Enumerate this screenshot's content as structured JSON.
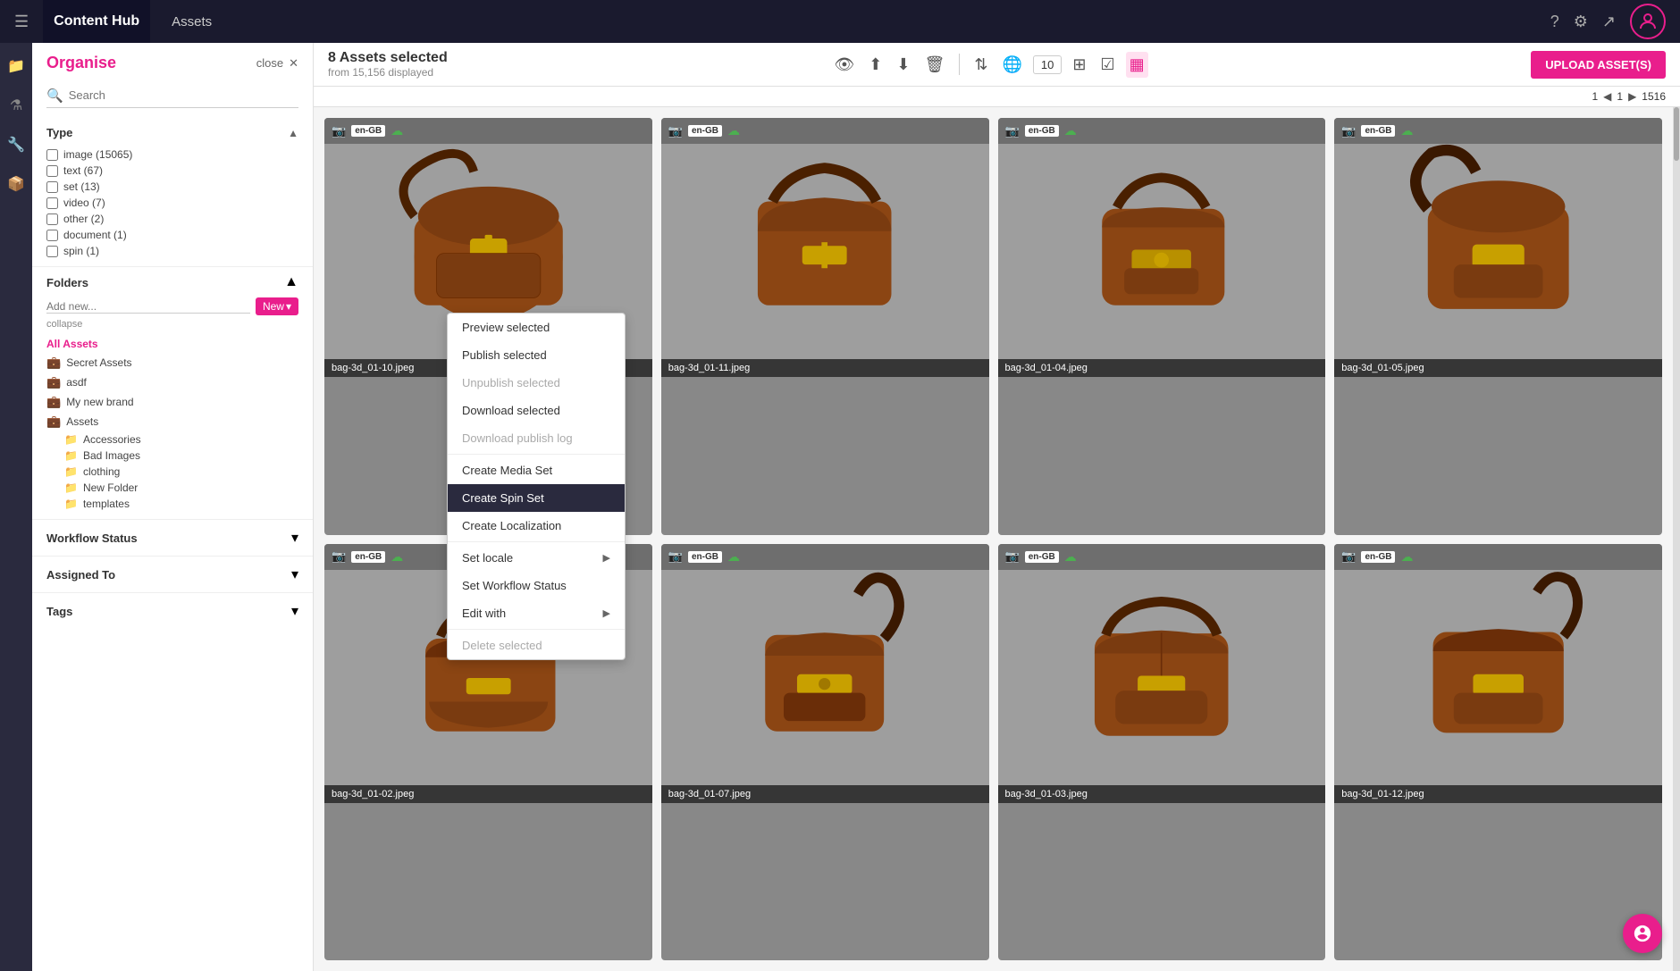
{
  "app": {
    "brand": "Content Hub",
    "page_title": "Assets"
  },
  "nav_icons": {
    "help": "?",
    "settings": "⚙",
    "export": "↗"
  },
  "sidebar": {
    "organise_label": "Organise",
    "close_label": "close",
    "search_placeholder": "Search",
    "type_section": {
      "title": "Type",
      "items": [
        {
          "label": "image (15065)"
        },
        {
          "label": "text (67)"
        },
        {
          "label": "set (13)"
        },
        {
          "label": "video (7)"
        },
        {
          "label": "other (2)"
        },
        {
          "label": "document (1)"
        },
        {
          "label": "spin (1)"
        }
      ]
    },
    "folders_section": {
      "title": "Folders",
      "add_placeholder": "Add new...",
      "new_btn": "New",
      "collapse_label": "collapse",
      "items": [
        {
          "label": "All Assets",
          "active": true,
          "level": 0
        },
        {
          "label": "Secret Assets",
          "level": 0,
          "icon": "briefcase"
        },
        {
          "label": "asdf",
          "level": 0,
          "icon": "briefcase"
        },
        {
          "label": "My new brand",
          "level": 0,
          "icon": "briefcase"
        },
        {
          "label": "Assets",
          "level": 0,
          "icon": "briefcase"
        },
        {
          "label": "Accessories",
          "level": 1,
          "icon": "folder"
        },
        {
          "label": "Bad Images",
          "level": 1,
          "icon": "folder"
        },
        {
          "label": "clothing",
          "level": 1,
          "icon": "folder"
        },
        {
          "label": "New Folder",
          "level": 1,
          "icon": "folder"
        },
        {
          "label": "templates",
          "level": 1,
          "icon": "folder"
        }
      ]
    },
    "workflow_status": {
      "title": "Workflow Status"
    },
    "assigned_to": {
      "title": "Assigned To"
    },
    "tags": {
      "title": "Tags"
    }
  },
  "toolbar": {
    "selected_count": "8 Assets selected",
    "displayed_from": "from 15,156 displayed",
    "upload_btn": "UPLOAD ASSET(S)",
    "page_size": "10"
  },
  "pagination": {
    "current_page": "1",
    "arrow_left": "◀",
    "page_display": "1",
    "arrow_right": "▶",
    "total_pages": "1516"
  },
  "assets": [
    {
      "id": "bag-3d_01-10.jpeg",
      "locale": "en-GB",
      "row": 0,
      "col": 0
    },
    {
      "id": "bag-3d_01-11.jpeg",
      "locale": "en-GB",
      "row": 0,
      "col": 1
    },
    {
      "id": "bag-3d_01-04.jpeg",
      "locale": "en-GB",
      "row": 0,
      "col": 2
    },
    {
      "id": "bag-3d_01-05.jpeg",
      "locale": "en-GB",
      "row": 0,
      "col": 3
    },
    {
      "id": "bag-3d_01-02.jpeg",
      "locale": "en-GB",
      "row": 1,
      "col": 0
    },
    {
      "id": "bag-3d_01-07.jpeg",
      "locale": "en-GB",
      "row": 1,
      "col": 1
    },
    {
      "id": "bag-3d_01-03.jpeg",
      "locale": "en-GB",
      "row": 1,
      "col": 2
    },
    {
      "id": "bag-3d_01-12.jpeg",
      "locale": "en-GB",
      "row": 1,
      "col": 3
    }
  ],
  "context_menu": {
    "items": [
      {
        "label": "Preview selected",
        "active": false,
        "disabled": false,
        "has_arrow": false
      },
      {
        "label": "Publish selected",
        "active": false,
        "disabled": false,
        "has_arrow": false
      },
      {
        "label": "Unpublish selected",
        "active": false,
        "disabled": true,
        "has_arrow": false
      },
      {
        "label": "Download selected",
        "active": false,
        "disabled": false,
        "has_arrow": false
      },
      {
        "label": "Download publish log",
        "active": false,
        "disabled": true,
        "has_arrow": false
      },
      {
        "separator": true
      },
      {
        "label": "Create Media Set",
        "active": false,
        "disabled": false,
        "has_arrow": false
      },
      {
        "label": "Create Spin Set",
        "active": true,
        "disabled": false,
        "has_arrow": false
      },
      {
        "label": "Create Localization",
        "active": false,
        "disabled": false,
        "has_arrow": false
      },
      {
        "separator": true
      },
      {
        "label": "Set locale",
        "active": false,
        "disabled": false,
        "has_arrow": true
      },
      {
        "label": "Set Workflow Status",
        "active": false,
        "disabled": false,
        "has_arrow": false
      },
      {
        "label": "Edit with",
        "active": false,
        "disabled": false,
        "has_arrow": true
      },
      {
        "separator": true
      },
      {
        "label": "Delete selected",
        "active": false,
        "disabled": true,
        "has_arrow": false
      }
    ]
  }
}
